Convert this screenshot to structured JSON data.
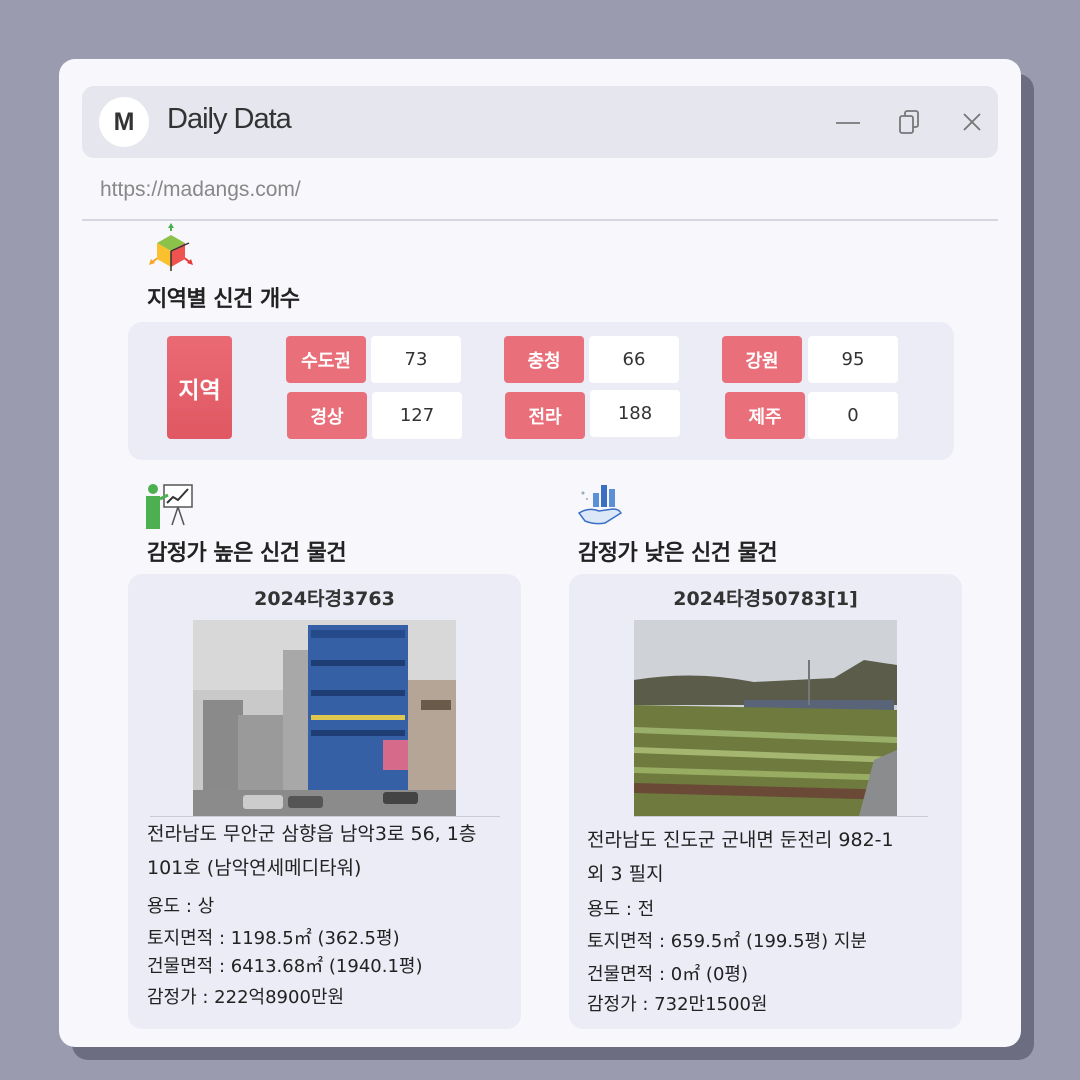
{
  "window": {
    "logo_letter": "M",
    "title": "Daily Data",
    "url": "https://madangs.com/",
    "controls": [
      "minimize-icon",
      "copy-icon",
      "close-icon"
    ]
  },
  "regions": {
    "title": "지역별 신건 개수",
    "main_label": "지역",
    "items": [
      {
        "name": "수도권",
        "count": "73"
      },
      {
        "name": "충청",
        "count": "66"
      },
      {
        "name": "강원",
        "count": "95"
      },
      {
        "name": "경상",
        "count": "127"
      },
      {
        "name": "전라",
        "count": "188"
      },
      {
        "name": "제주",
        "count": "0"
      }
    ]
  },
  "high": {
    "title": "감정가 높은 신건 물건",
    "case": "2024타경3763",
    "address_line1": "전라남도 무안군 삼향읍 남악3로 56, 1층",
    "address_line2": "101호 (남악연세메디타워)",
    "usage": "용도 : 상",
    "land_area": "토지면적 : 1198.5㎡ (362.5평)",
    "building_area": "건물면적 : 6413.68㎡ (1940.1평)",
    "appraisal": "감정가 : 222억8900만원"
  },
  "low": {
    "title": "감정가 낮은 신건 물건",
    "case": "2024타경50783[1]",
    "address_line1": "전라남도 진도군 군내면 둔전리 982-1",
    "address_line2": "외 3 필지",
    "usage": "용도 : 전",
    "land_area": "토지면적 : 659.5㎡ (199.5평) 지분",
    "building_area": "건물면적 : 0㎡ (0평)",
    "appraisal": "감정가 : 732만1500원"
  },
  "colors": {
    "background": "#9a9bae",
    "window": "#f7f7fc",
    "panel": "#ebecf5",
    "accent_red": "#e9707a"
  }
}
